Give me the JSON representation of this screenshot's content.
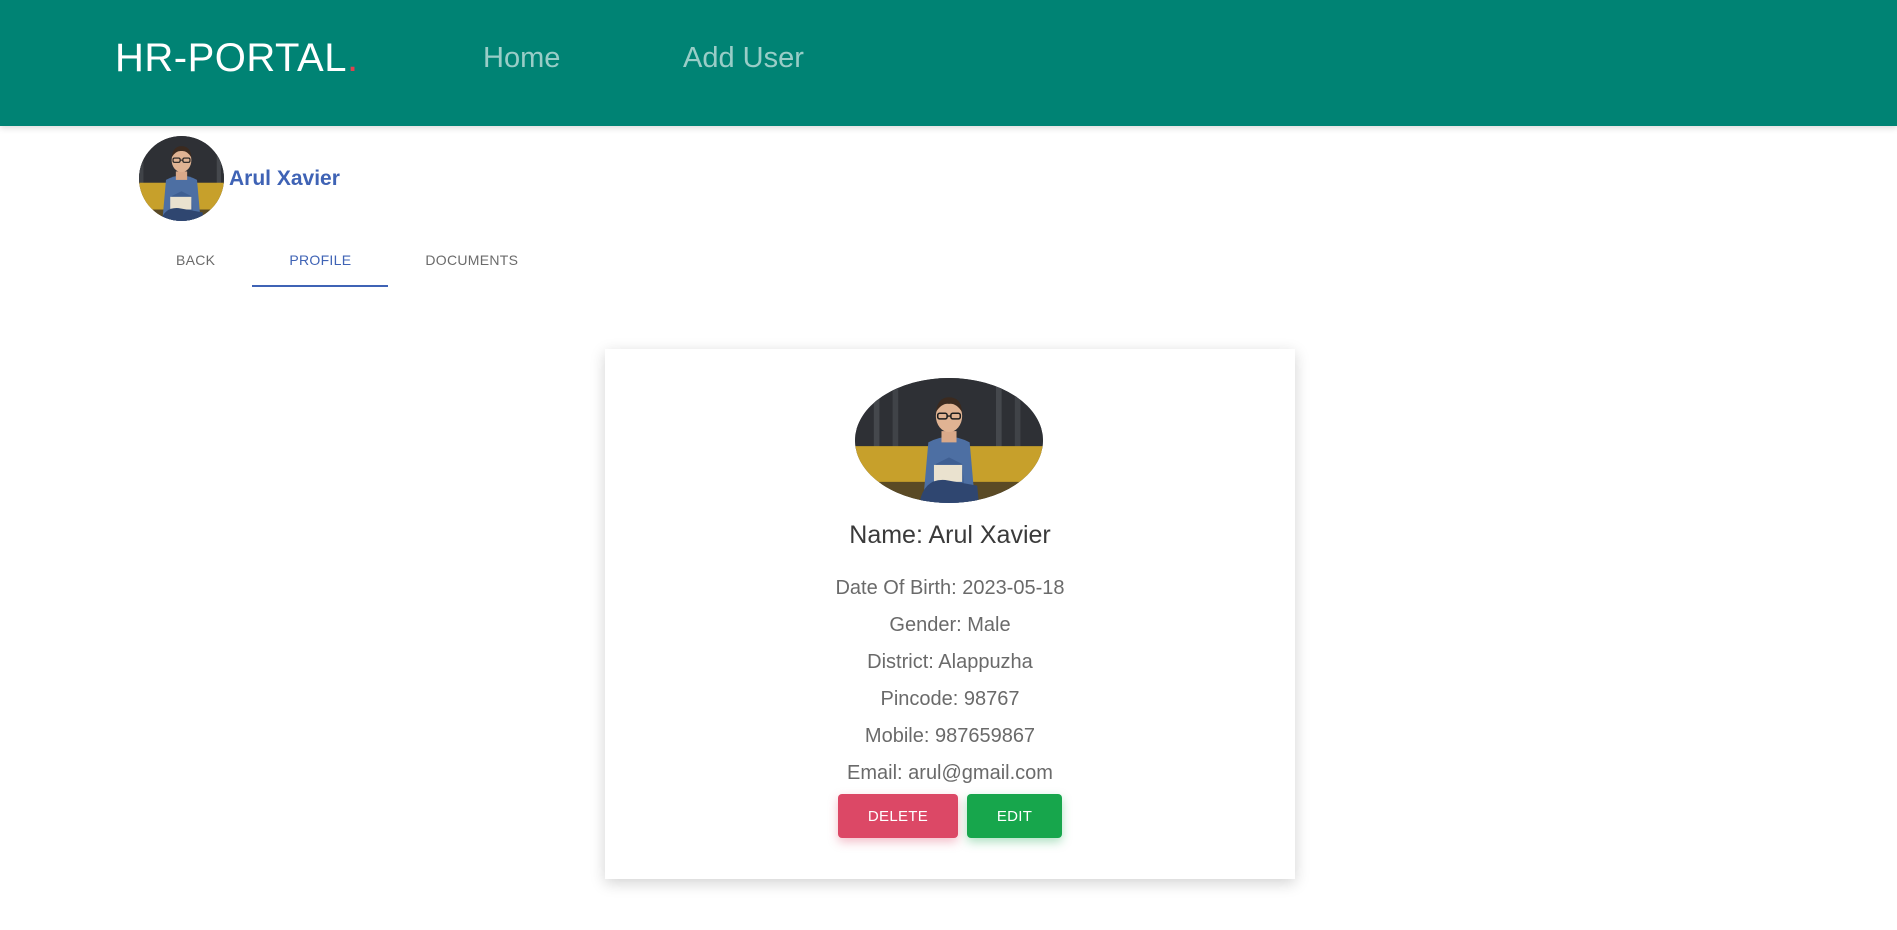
{
  "navbar": {
    "brand": "HR-PORTAL",
    "brand_dot": ".",
    "links": [
      {
        "label": "Home"
      },
      {
        "label": "Add User"
      }
    ],
    "colors": {
      "background": "#008374",
      "dot": "#e0414f"
    }
  },
  "profile_header": {
    "name": "Arul Xavier",
    "avatar_icon": "person-photo"
  },
  "tabs": [
    {
      "label": "BACK",
      "active": false
    },
    {
      "label": "PROFILE",
      "active": true
    },
    {
      "label": "DOCUMENTS",
      "active": false
    }
  ],
  "card": {
    "name_line": "Name: Arul Xavier",
    "details": [
      "Date Of Birth: 2023-05-18",
      "Gender: Male",
      "District: Alappuzha",
      "Pincode: 98767",
      "Mobile: 987659867",
      "Email: arul@gmail.com"
    ],
    "delete_label": "DELETE",
    "edit_label": "EDIT",
    "colors": {
      "delete": "#dc4866",
      "edit": "#17a64c",
      "accent": "#3f63b5"
    }
  }
}
